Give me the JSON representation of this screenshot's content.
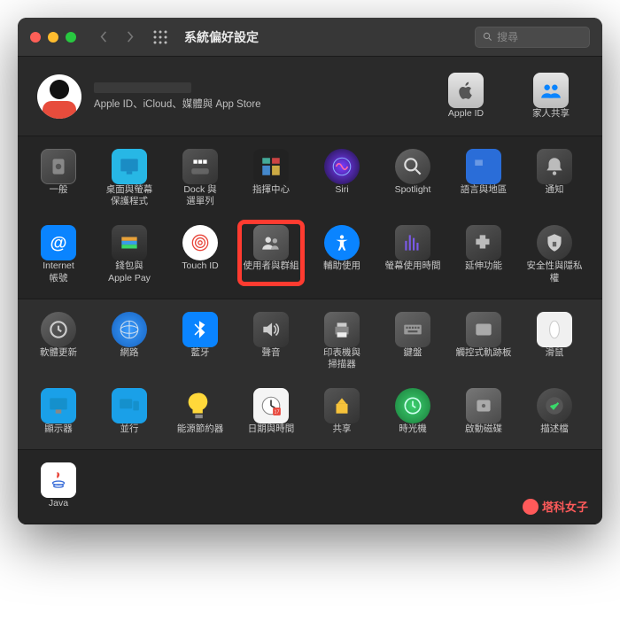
{
  "titlebar": {
    "title": "系統偏好設定",
    "search_placeholder": "搜尋"
  },
  "account": {
    "subtitle": "Apple ID、iCloud、媒體與 App Store",
    "items": [
      {
        "key": "appleid",
        "label": "Apple ID"
      },
      {
        "key": "family",
        "label": "家人共享"
      }
    ]
  },
  "sections": [
    {
      "tone": "darker",
      "items": [
        {
          "key": "general",
          "label": "一般"
        },
        {
          "key": "desktop",
          "label": "桌面與螢幕\n保護程式"
        },
        {
          "key": "dock",
          "label": "Dock 與\n選單列"
        },
        {
          "key": "mission",
          "label": "指揮中心"
        },
        {
          "key": "siri",
          "label": "Siri"
        },
        {
          "key": "spotlight",
          "label": "Spotlight"
        },
        {
          "key": "lang",
          "label": "語言與地區"
        },
        {
          "key": "notif",
          "label": "通知"
        },
        {
          "key": "internet",
          "label": "Internet\n帳號"
        },
        {
          "key": "wallet",
          "label": "錢包與\nApple Pay"
        },
        {
          "key": "touchid",
          "label": "Touch ID"
        },
        {
          "key": "users",
          "label": "使用者與群組",
          "highlighted": true
        },
        {
          "key": "access",
          "label": "輔助使用"
        },
        {
          "key": "screentime",
          "label": "螢幕使用時間"
        },
        {
          "key": "ext",
          "label": "延伸功能"
        },
        {
          "key": "security",
          "label": "安全性與隱私權"
        }
      ]
    },
    {
      "tone": "lighter",
      "items": [
        {
          "key": "update",
          "label": "軟體更新"
        },
        {
          "key": "network",
          "label": "網路"
        },
        {
          "key": "bt",
          "label": "藍牙"
        },
        {
          "key": "sound",
          "label": "聲音"
        },
        {
          "key": "printer",
          "label": "印表機與\n掃描器"
        },
        {
          "key": "keyboard",
          "label": "鍵盤"
        },
        {
          "key": "trackpad",
          "label": "觸控式軌跡板"
        },
        {
          "key": "mouse",
          "label": "滑鼠"
        },
        {
          "key": "display",
          "label": "顯示器"
        },
        {
          "key": "sidecar",
          "label": "並行"
        },
        {
          "key": "energy",
          "label": "能源節約器"
        },
        {
          "key": "datetime",
          "label": "日期與時間"
        },
        {
          "key": "sharing",
          "label": "共享"
        },
        {
          "key": "timemachine",
          "label": "時光機"
        },
        {
          "key": "startup",
          "label": "啟動磁碟"
        },
        {
          "key": "profile",
          "label": "描述檔"
        }
      ]
    },
    {
      "tone": "darker",
      "items": [
        {
          "key": "java",
          "label": "Java"
        }
      ],
      "watermark": "塔科女子"
    }
  ],
  "colors": {
    "highlight": "#ff3b30"
  }
}
